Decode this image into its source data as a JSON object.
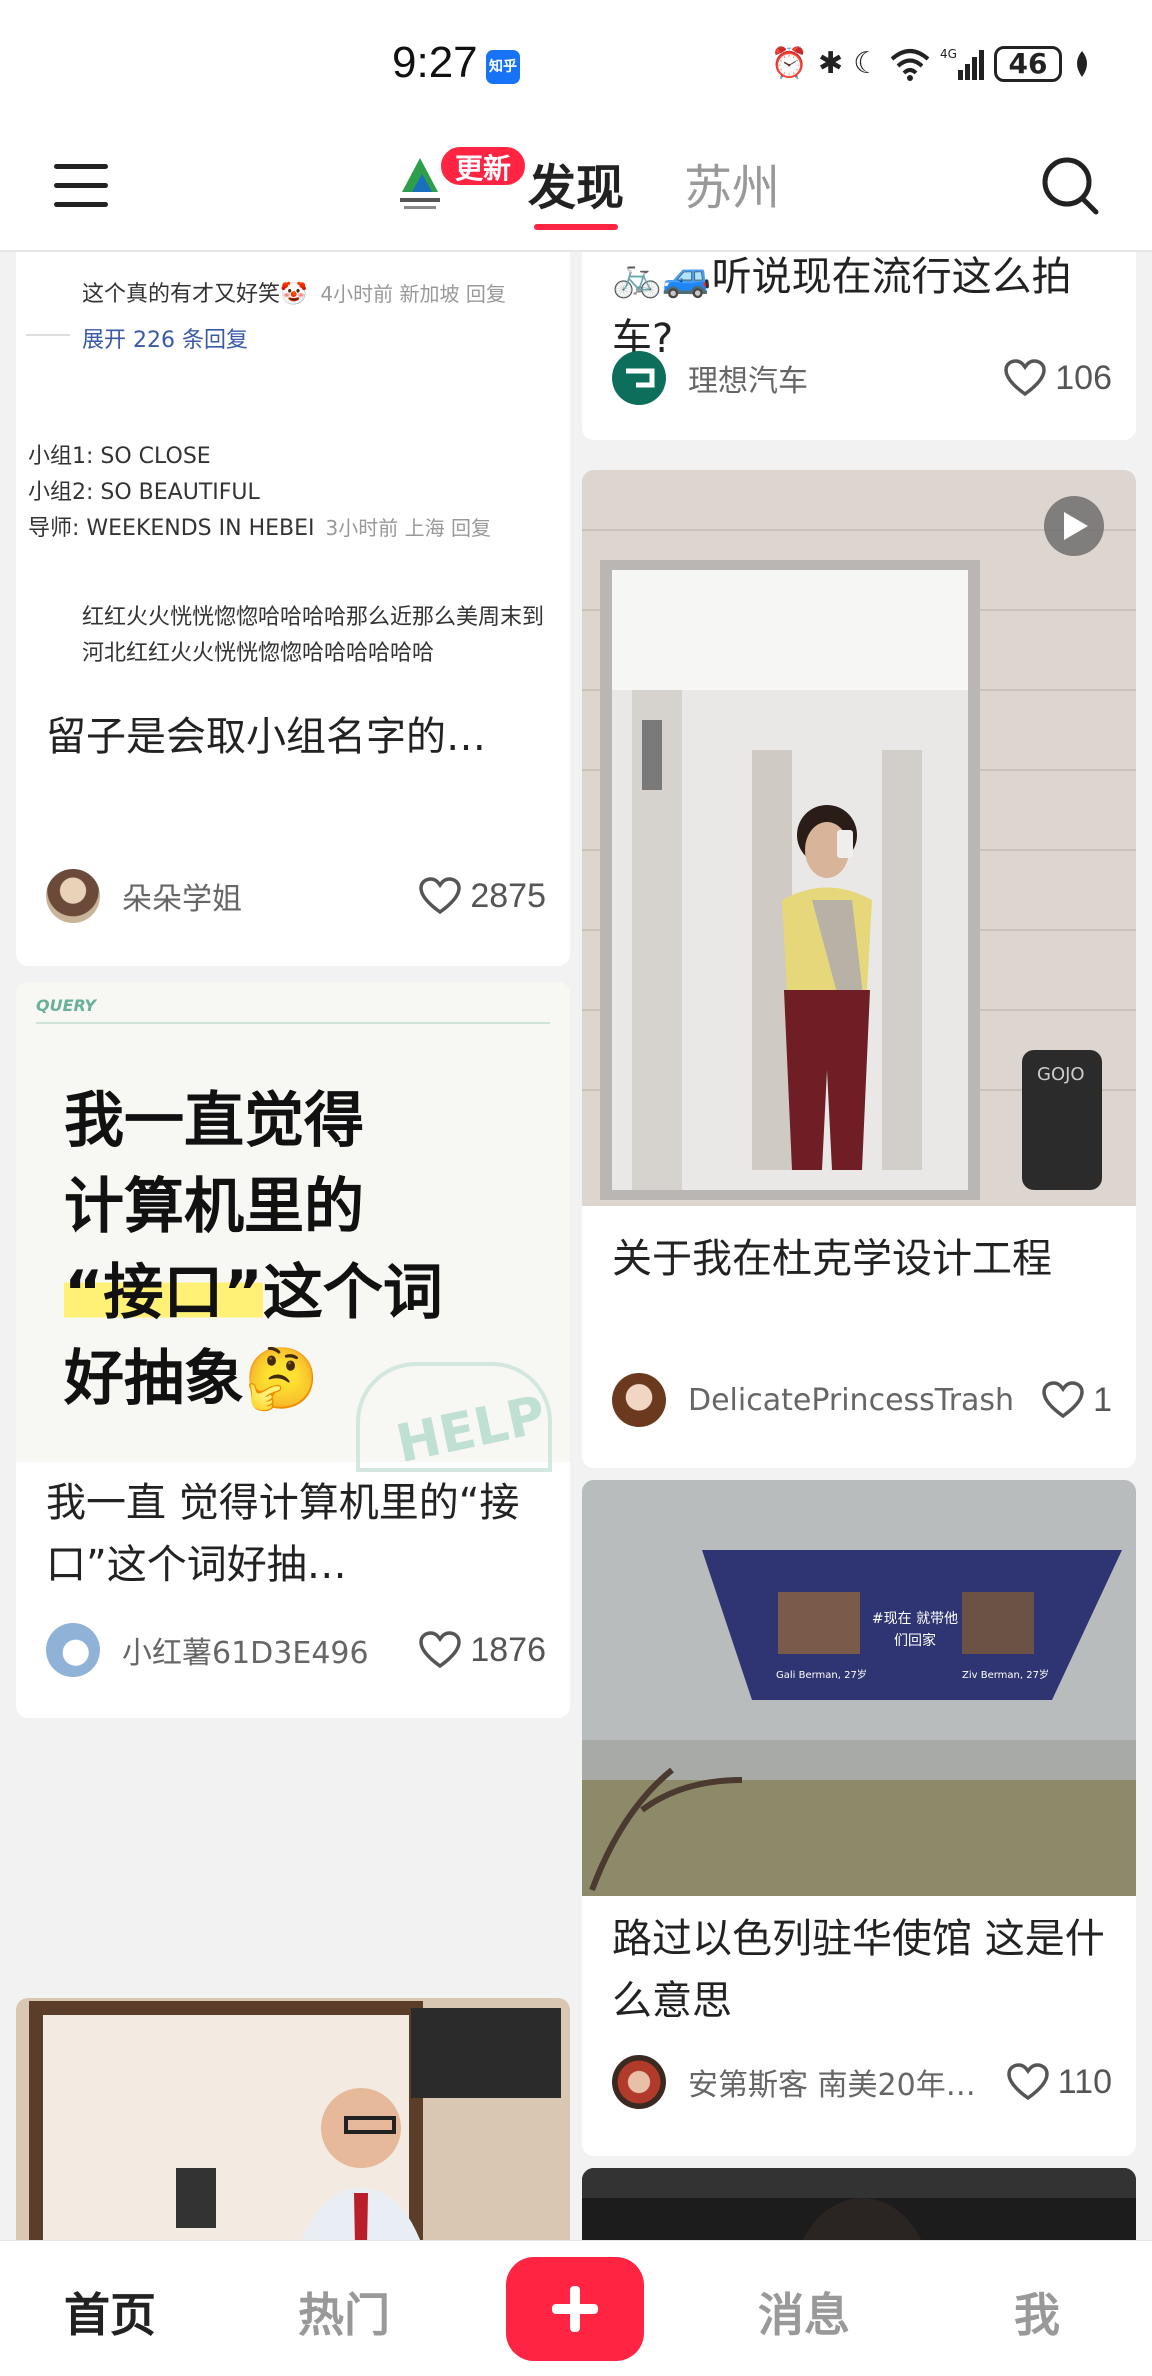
{
  "status_bar": {
    "time": "9:27",
    "app_badge": "知乎",
    "battery": "46"
  },
  "header": {
    "update_badge": "更新",
    "tab_active": "发现",
    "tab_city": "苏州"
  },
  "feed": {
    "card1": {
      "comment1": "这个真的有才又好笑🤡",
      "comment1_meta": "4小时前 新加坡 回复",
      "expand_replies": "展开 226 条回复",
      "group1": "小组1:  SO CLOSE",
      "group2": "小组2:  SO BEAUTIFUL",
      "mentor": "导师:  WEEKENDS IN HEBEI",
      "mentor_meta": "3小时前 上海 回复",
      "comment2": "红红火火恍恍惚惚哈哈哈哈那么近那么美周末到河北红红火火恍恍惚惚哈哈哈哈哈哈",
      "title": "留子是会取小组名字的…",
      "author": "朵朵学姐",
      "likes": "2875"
    },
    "card2": {
      "tag": "QUERY",
      "line1": "我一直觉得",
      "line2": "计算机里的",
      "line3_highlight": "“接口”",
      "line3_rest": "这个词",
      "line4": "好抽象🤔",
      "help_text": "HELP",
      "title": "我一直 觉得计算机里的“接口”这个词好抽…",
      "author": "小红薯61D3E496",
      "likes": "1876"
    },
    "card_top_right": {
      "title": "🚲🚙听说现在流行这么拍车?",
      "author": "理想汽车",
      "likes": "106"
    },
    "card_video": {
      "title": "关于我在杜克学设计工程",
      "author": "DelicatePrincessTrash",
      "likes": "1"
    },
    "card_embassy": {
      "billboard_center": "#现在 就带他们回家",
      "billboard_left": "Gali Berman, 27岁",
      "billboard_right": "Ziv Berman, 27岁",
      "title": "路过以色列驻华使馆 这是什么意思",
      "author": "安第斯客 南美20年…",
      "likes": "110"
    }
  },
  "bottom_nav": {
    "home": "首页",
    "hot": "热门",
    "messages": "消息",
    "me": "我"
  },
  "colors": {
    "accent": "#ff2442",
    "background": "#f2f2f2"
  }
}
